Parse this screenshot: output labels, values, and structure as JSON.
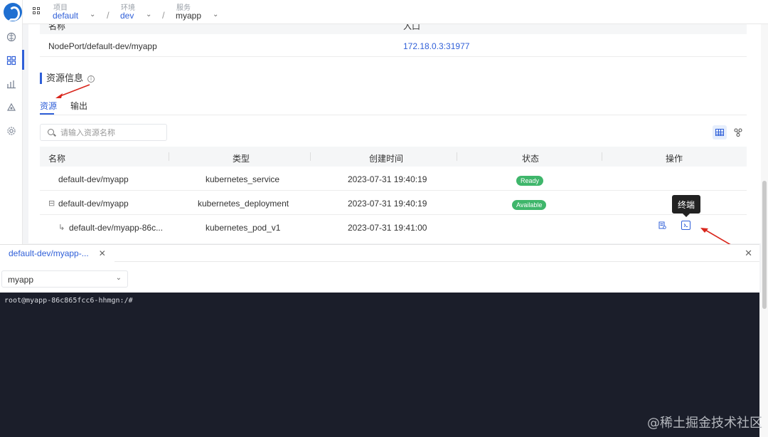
{
  "header": {
    "crumbs": [
      {
        "label": "项目",
        "value": "default"
      },
      {
        "label": "环境",
        "value": "dev"
      },
      {
        "label": "服务",
        "value": "myapp"
      }
    ]
  },
  "access": {
    "col_name": "名称",
    "col_entry": "入口",
    "row": {
      "name": "NodePort/default-dev/myapp",
      "entry": "172.18.0.3:31977"
    }
  },
  "section": {
    "title": "资源信息"
  },
  "tabs": [
    {
      "label": "资源"
    },
    {
      "label": "输出"
    }
  ],
  "search": {
    "placeholder": "请输入资源名称"
  },
  "resources": {
    "columns": [
      "名称",
      "类型",
      "创建时间",
      "状态",
      "操作"
    ],
    "rows": [
      {
        "name": "default-dev/myapp",
        "type": "kubernetes_service",
        "created": "2023-07-31 19:40:19",
        "status": "Ready"
      },
      {
        "name": "default-dev/myapp",
        "type": "kubernetes_deployment",
        "created": "2023-07-31 19:40:19",
        "status": "Available"
      },
      {
        "name": "default-dev/myapp-86c...",
        "type": "kubernetes_pod_v1",
        "created": "2023-07-31 19:41:00",
        "status": ""
      }
    ]
  },
  "tooltip": {
    "text": "终端"
  },
  "terminal": {
    "tab_label": "default-dev/myapp-...",
    "container": "myapp",
    "prompt": "root@myapp-86c865fcc6-hhmgn:/#"
  },
  "watermark": "@稀土掘金技术社区",
  "colors": {
    "accent": "#2f5fd8",
    "status_green": "#3fb66b",
    "terminal_bg": "#1b1e2a",
    "annotation": "#d9261c"
  }
}
